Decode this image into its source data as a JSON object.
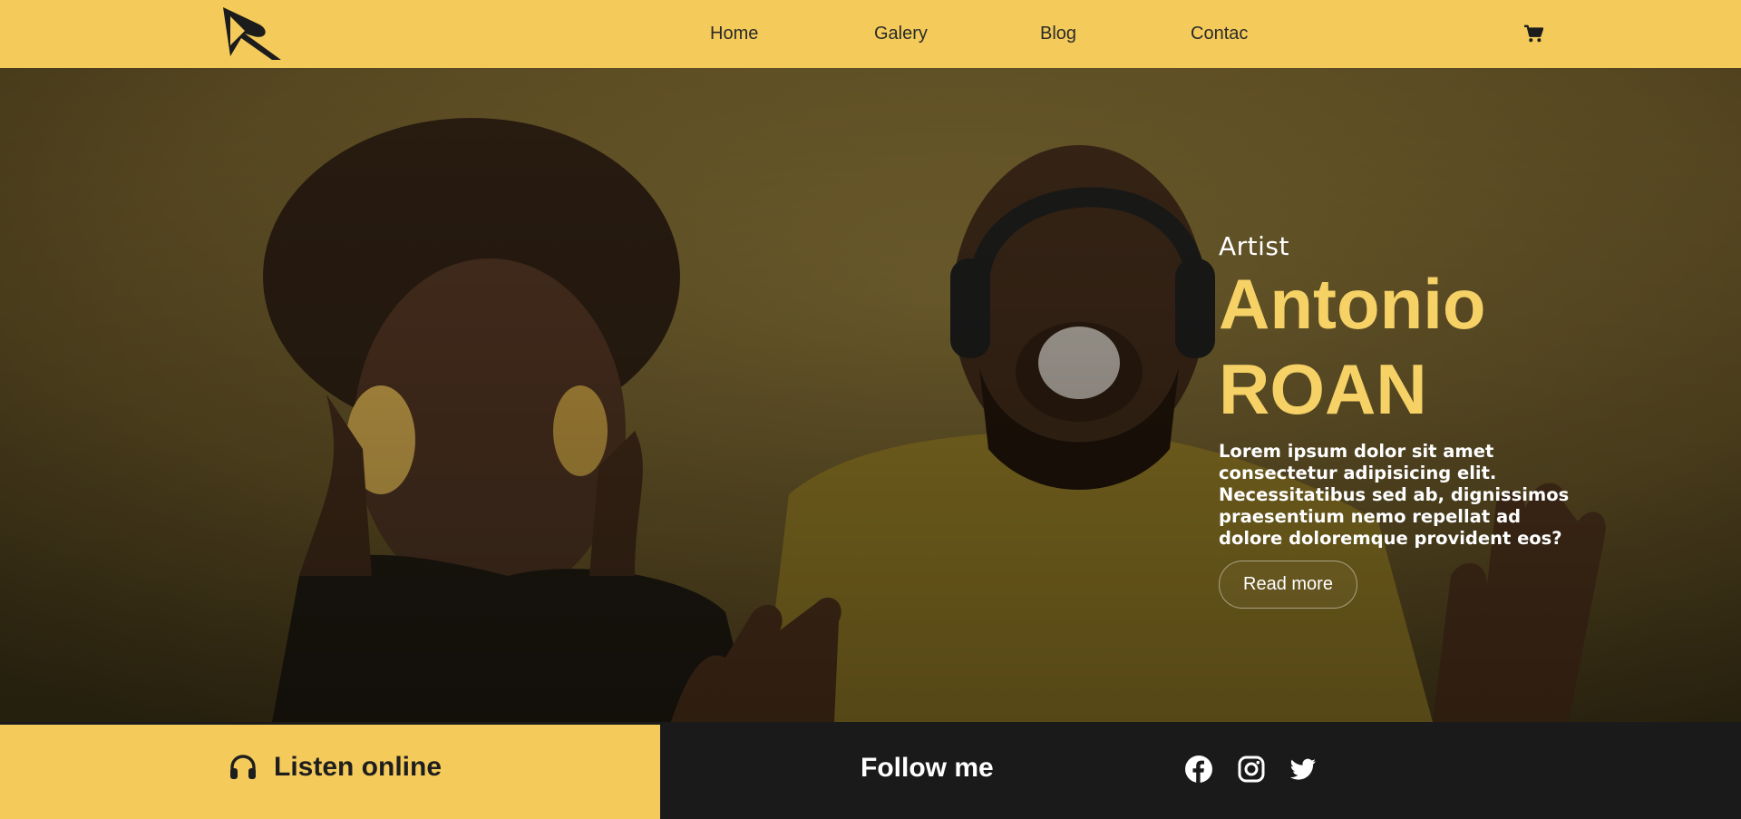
{
  "nav": {
    "links": [
      "Home",
      "Galery",
      "Blog",
      "Contac"
    ],
    "cart_icon": "shopping-cart-icon",
    "logo": "brand-logo"
  },
  "hero": {
    "label": "Artist",
    "name_first": "Antonio",
    "name_last": "ROAN",
    "bio": "Lorem ipsum dolor sit amet consectetur adipisicing elit. Necessitatibus sed ab, dignissimos praesentium nemo repellat ad dolore doloremque provident eos?",
    "button": "Read more"
  },
  "bottom": {
    "listen_label": "Listen online",
    "listen_icon": "headphones-icon",
    "follow_label": "Follow me",
    "social_icons": [
      "facebook-icon",
      "instagram-icon",
      "twitter-icon"
    ]
  },
  "colors": {
    "accent": "#f4cb5a",
    "name_accent": "#f6d166",
    "dark": "#1a1a1a"
  }
}
